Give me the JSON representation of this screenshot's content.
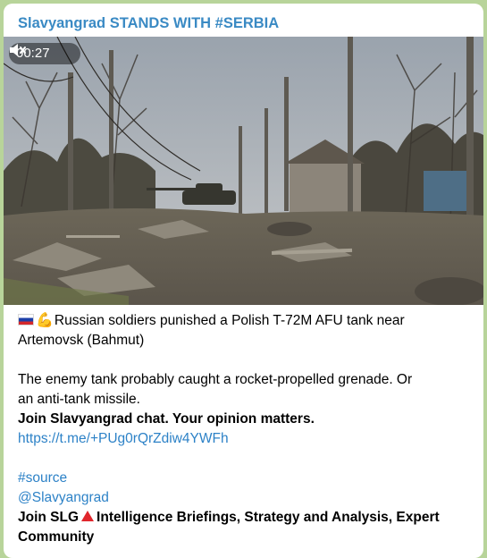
{
  "post": {
    "channel_name": "Slavyangrad STANDS WITH #SERBIA",
    "video": {
      "duration": "00:27",
      "mute_icon": "muted-speaker-icon"
    },
    "lines": {
      "flag_icon": "russia-flag-icon",
      "muscle_icon": "flexed-biceps-icon",
      "headline_1": "Russian soldiers punished a Polish T-72M AFU tank near",
      "headline_2": "Artemovsk (Bahmut)",
      "body_1": "The enemy tank probably caught a rocket-propelled grenade. Or",
      "body_2": "an anti-tank missile.",
      "cta_chat": "Join Slavyangrad chat. Your opinion matters.",
      "chat_link": "https://t.me/+PUg0rQrZdiw4YWFh",
      "hashtag": "#source",
      "mention": "@Slavyangrad",
      "join_prefix": "Join SLG",
      "warning_icon": "red-triangle-icon",
      "join_suffix": "Intelligence Briefings, Strategy and Analysis, Expert",
      "join_suffix_2": "Community"
    }
  },
  "colors": {
    "channel_name": "#3a8ac4",
    "link": "#2d82c7",
    "background": "#b8d49a"
  }
}
